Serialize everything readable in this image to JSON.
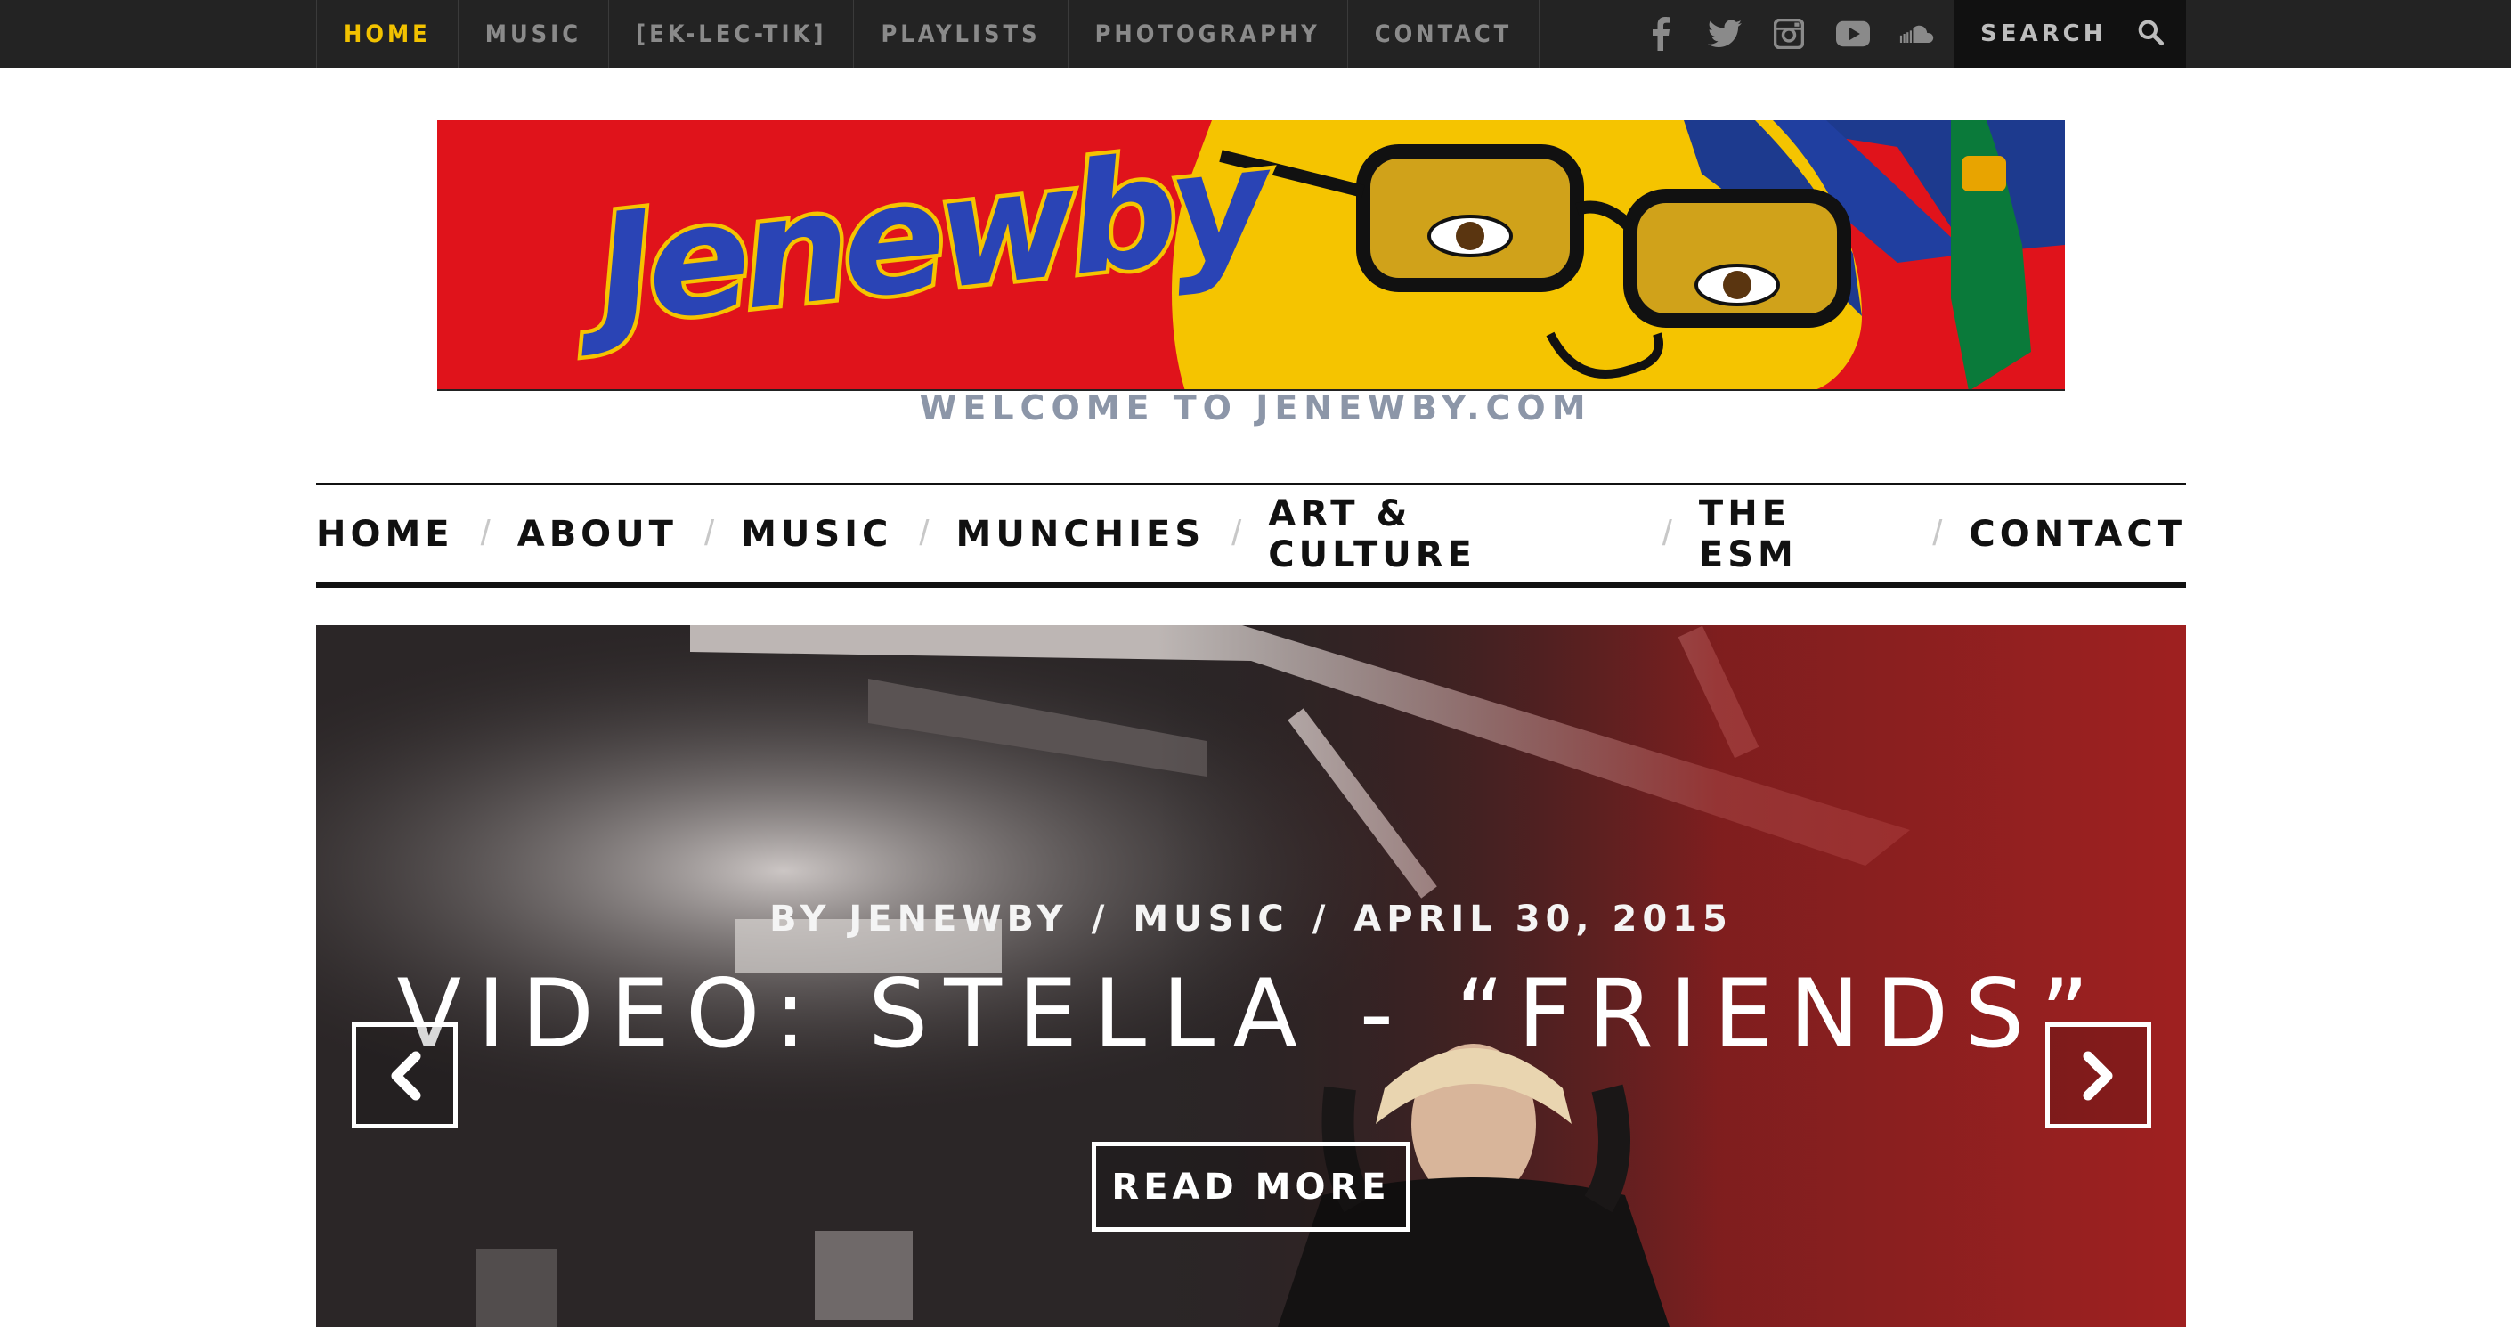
{
  "topnav": {
    "items": [
      {
        "label": "HOME",
        "active": true
      },
      {
        "label": "MUSIC",
        "active": false
      },
      {
        "label": "[EK-LEC-TIK]",
        "active": false
      },
      {
        "label": "PLAYLISTS",
        "active": false
      },
      {
        "label": "PHOTOGRAPHY",
        "active": false
      },
      {
        "label": "CONTACT",
        "active": false
      }
    ],
    "social_icons": [
      "facebook-icon",
      "twitter-icon",
      "instagram-icon",
      "youtube-icon",
      "soundcloud-icon"
    ],
    "search_placeholder": "SEARCH",
    "active_color": "#f2c200"
  },
  "banner": {
    "logo_text": "Jenewby"
  },
  "tagline": "WELCOME TO JENEWBY.COM",
  "mainnav": {
    "items": [
      "HOME",
      "ABOUT",
      "MUSIC",
      "MUNCHIES",
      "ART & CULTURE",
      "THE ESM",
      "CONTACT"
    ],
    "separator": "/"
  },
  "hero": {
    "meta_author": "BY JENEWBY",
    "meta_category": "MUSIC",
    "meta_date": "APRIL 30, 2015",
    "meta_sep": "/",
    "title": "VIDEO: STELLA - “FRIENDS”",
    "read_more": "READ MORE"
  }
}
